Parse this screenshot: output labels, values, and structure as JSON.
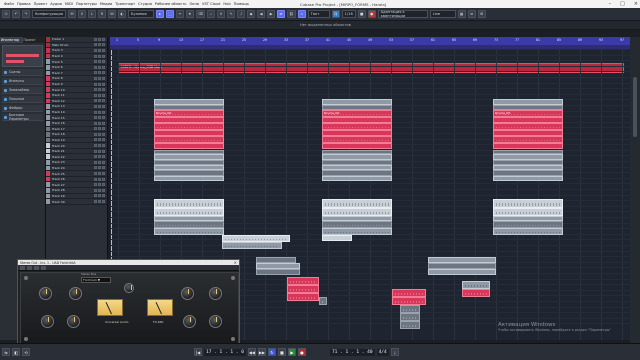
{
  "app": {
    "window_title": "Cubase Pro Project - [MIRPO_FORMS - Harola]",
    "menu": [
      "Файл",
      "Правка",
      "Проект",
      "Аудио",
      "MIDI",
      "Партитуры",
      "Медиа",
      "Транспорт",
      "Студия",
      "Рабочее область",
      "Окна",
      "VST Cloud",
      "Hub",
      "Помощь"
    ]
  },
  "toolbar": {
    "mode_field": "Конфигурация",
    "tool_field": "Бузимок",
    "snap_field": "Такт",
    "quantize_field": "1/16",
    "right_field": "Адаптация к квантизации",
    "link_field": "Line"
  },
  "subbar": {
    "center_label": "Нет выделенных объектов"
  },
  "inspector": {
    "tabs": [
      "Инспектор",
      "Проект",
      "Визуализация"
    ],
    "rows": [
      "Сцены",
      "Инсерты",
      "Эквалайзер",
      "Посылки",
      "Фейдер",
      "Быстрые Параметры"
    ]
  },
  "tracks": [
    {
      "name": "Folder 1",
      "color": "#b02a3c"
    },
    {
      "name": "Main Drum",
      "color": "#b02a3c"
    },
    {
      "name": "Track 3",
      "color": "#c9324c"
    },
    {
      "name": "Track 4",
      "color": "#c9324c"
    },
    {
      "name": "Track 5",
      "color": "#8f9aa6"
    },
    {
      "name": "Track 6",
      "color": "#8f9aa6"
    },
    {
      "name": "Track 7",
      "color": "#8f9aa6"
    },
    {
      "name": "Track 8",
      "color": "#d8365a"
    },
    {
      "name": "Track 9",
      "color": "#d8365a"
    },
    {
      "name": "Track 10",
      "color": "#d8365a"
    },
    {
      "name": "Track 11",
      "color": "#d8365a"
    },
    {
      "name": "Track 12",
      "color": "#d8365a"
    },
    {
      "name": "Track 13",
      "color": "#8f9aa6"
    },
    {
      "name": "Track 14",
      "color": "#8f9aa6"
    },
    {
      "name": "Track 15",
      "color": "#8f9aa6"
    },
    {
      "name": "Track 16",
      "color": "#8f9aa6"
    },
    {
      "name": "Track 17",
      "color": "#6c7580"
    },
    {
      "name": "Track 18",
      "color": "#6c7580"
    },
    {
      "name": "Track 19",
      "color": "#6c7580"
    },
    {
      "name": "Track 20",
      "color": "#c8cfd7"
    },
    {
      "name": "Track 21",
      "color": "#c8cfd7"
    },
    {
      "name": "Track 22",
      "color": "#c8cfd7"
    },
    {
      "name": "Track 23",
      "color": "#8f9aa6"
    },
    {
      "name": "Track 24",
      "color": "#8f9aa6"
    },
    {
      "name": "Track 25",
      "color": "#d8365a"
    },
    {
      "name": "Track 26",
      "color": "#d8365a"
    },
    {
      "name": "Track 27",
      "color": "#8f9aa6"
    },
    {
      "name": "Track 28",
      "color": "#8f9aa6"
    },
    {
      "name": "Track 29",
      "color": "#8f9aa6"
    },
    {
      "name": "Track 30",
      "color": "#8f9aa6"
    }
  ],
  "ruler": {
    "ticks": [
      "1",
      "5",
      "9",
      "13",
      "17",
      "21",
      "25",
      "29",
      "33",
      "37",
      "41",
      "45",
      "49",
      "53",
      "57",
      "61",
      "65",
      "69",
      "73",
      "77",
      "81",
      "85",
      "89",
      "93",
      "97"
    ]
  },
  "arrangement": {
    "top_clip_label": "MIRPO - Mypco_OSB Main",
    "pink_label": "Drums_Kit"
  },
  "plugin": {
    "title": "Stereo Out - Ins. 1 - UAD FairchildA",
    "preset_label": "Stereo Bus",
    "preset": "Fnl Drum ▼",
    "model": "FX-660",
    "brand": "Universal Audio"
  },
  "transport": {
    "time_display": "17 . 1 . 1 . 0",
    "position": "71 . 1 . 1 . 40",
    "tempo": "4/4"
  },
  "watermark": {
    "line1": "Активация Windows",
    "line2": "Чтобы активировать Windows, перейдите в раздел \"Параметры\""
  },
  "colors": {
    "accent": "#5b6af0",
    "ruler": "#3a3aa8",
    "clip_red": "#c8304a",
    "clip_pink": "#d8365a"
  }
}
